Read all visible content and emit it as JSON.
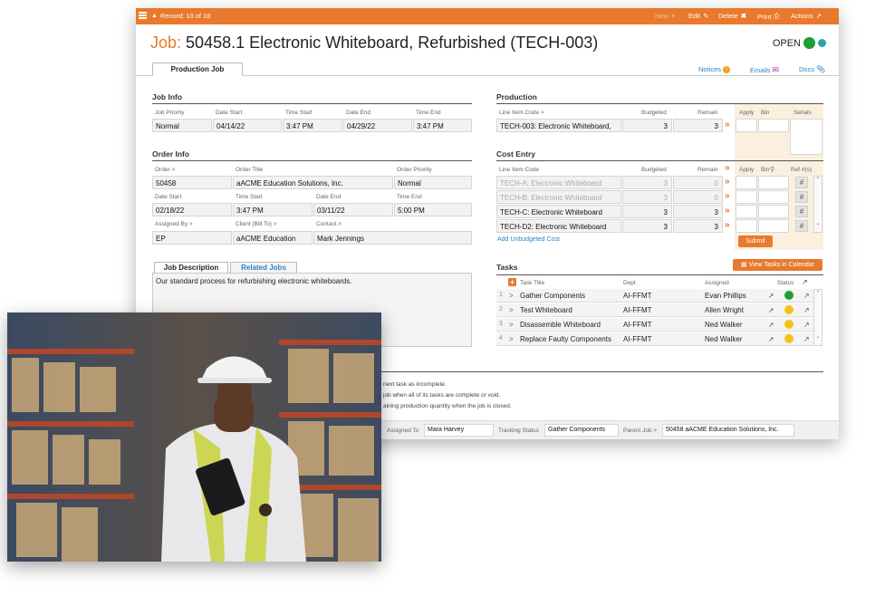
{
  "topbar": {
    "record": "Record: 10 of 18",
    "new": "New",
    "edit": "Edit",
    "delete": "Delete",
    "print": "Print",
    "actions": "Actions"
  },
  "header": {
    "prefix": "Job:",
    "title": "50458.1 Electronic Whiteboard, Refurbished (TECH-003)",
    "status": "OPEN",
    "status_color": "#1e9e33"
  },
  "tabs": {
    "production_job": "Production Job",
    "notices": "Notices",
    "emails": "Emails",
    "docs": "Docs"
  },
  "job_info": {
    "heading": "Job Info",
    "labels": [
      "Job Priority",
      "Date Start",
      "Time Start",
      "Date End",
      "Time End"
    ],
    "values": [
      "Normal",
      "04/14/22",
      "3:47 PM",
      "04/29/22",
      "3:47 PM"
    ]
  },
  "order_info": {
    "heading": "Order Info",
    "labels1": [
      "Order >",
      "Order Title",
      "Order Priority"
    ],
    "values1": [
      "50458",
      "aACME Education Solutions, Inc.",
      "Normal"
    ],
    "labels2": [
      "Date Start",
      "Time Start",
      "Date End",
      "Time End"
    ],
    "values2": [
      "02/18/22",
      "3:47 PM",
      "03/11/22",
      "5:00 PM"
    ],
    "labels3": [
      "Assigned By >",
      "Client (Bill To) >",
      "Contact >"
    ],
    "values3": [
      "EP",
      "aACME Education",
      "Mark Jennings"
    ]
  },
  "production": {
    "heading": "Production",
    "labels": [
      "Line Item Code >",
      "Budgeted",
      "Remain",
      "Apply",
      "Bin",
      "Serials"
    ],
    "row": {
      "code": "TECH-003: Electronic Whiteboard,",
      "budgeted": "3",
      "remain": "3"
    }
  },
  "cost_entry": {
    "heading": "Cost Entry",
    "labels": [
      "Line Item Code",
      "Budgeted",
      "Remain",
      "Apply",
      "Bin",
      "Ref #(s)"
    ],
    "rows": [
      {
        "code": "TECH-A: Electronic Whiteboard",
        "budgeted": "3",
        "remain": "0"
      },
      {
        "code": "TECH-B: Electronic Whiteboard",
        "budgeted": "3",
        "remain": "0"
      },
      {
        "code": "TECH-C: Electronic Whiteboard",
        "budgeted": "3",
        "remain": "3"
      },
      {
        "code": "TECH-D2: Electronic Whiteboard",
        "budgeted": "3",
        "remain": "3"
      }
    ],
    "add_link": "Add Unbudgeted Cost",
    "submit": "Submit"
  },
  "description": {
    "tab_active": "Job Description",
    "tab_other": "Related Jobs",
    "text": "Our standard process for refurbishing electronic whiteboards."
  },
  "tasks": {
    "heading": "Tasks",
    "calendar_button": "View Tasks in Calendar",
    "labels": [
      "Task Title",
      "Dept",
      "Assigned",
      "Status"
    ],
    "rows": [
      {
        "n": "1",
        "title": "Gather Components",
        "dept": "AI-FFMT",
        "assigned": "Evan Phillips",
        "color": "#1e9e33"
      },
      {
        "n": "2",
        "title": "Test Whiteboard",
        "dept": "AI-FFMT",
        "assigned": "Allen Wright",
        "color": "#f2c21b"
      },
      {
        "n": "3",
        "title": "Disassemble Whiteboard",
        "dept": "AI-FFMT",
        "assigned": "Ned Walker",
        "color": "#f2c21b"
      },
      {
        "n": "4",
        "title": "Replace Faulty Components",
        "dept": "AI-FFMT",
        "assigned": "Ned Walker",
        "color": "#f2c21b"
      }
    ]
  },
  "notes": [
    "next task as incomplete.",
    "job when all of its tasks are complete or void.",
    "aining production quantity when the job is closed."
  ],
  "footer": {
    "assigned_label": "Assigned To",
    "assigned_value": "Mara Harvey",
    "tracking_label": "Tracking Status",
    "tracking_value": "Gather Components",
    "parent_label": "Parent Job >",
    "parent_value": "50458 aACME Education Solutions, Inc."
  },
  "icons": [
    "menu-icon",
    "record-arrows-icon",
    "plus-icon",
    "pencil-icon",
    "x-icon",
    "printer-icon",
    "expand-arrow-icon",
    "clock-icon",
    "warning-icon",
    "envelope-icon",
    "paperclip-icon",
    "calendar-icon",
    "pin-icon",
    "hash-icon"
  ]
}
